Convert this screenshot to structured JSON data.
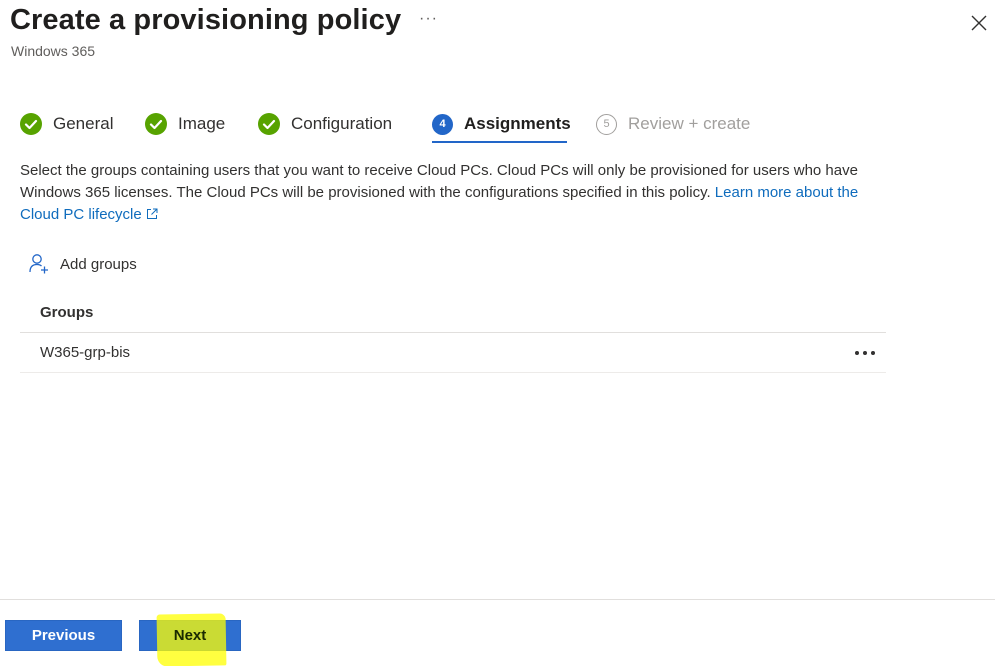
{
  "header": {
    "title": "Create a provisioning policy",
    "more": "···",
    "subtitle": "Windows 365"
  },
  "steps": [
    {
      "label": "General",
      "state": "completed"
    },
    {
      "label": "Image",
      "state": "completed"
    },
    {
      "label": "Configuration",
      "state": "completed"
    },
    {
      "label": "Assignments",
      "state": "active",
      "number": "4"
    },
    {
      "label": "Review + create",
      "state": "pending",
      "number": "5"
    }
  ],
  "description": {
    "text": "Select the groups containing users that you want to receive Cloud PCs. Cloud PCs will only be provisioned for users who have Windows 365 licenses. The Cloud PCs will be provisioned with the configurations specified in this policy. ",
    "link": "Learn more about the Cloud PC lifecycle"
  },
  "toolbar": {
    "add_groups_label": "Add groups"
  },
  "table": {
    "header": "Groups",
    "rows": [
      {
        "name": "W365-grp-bis"
      }
    ]
  },
  "footer": {
    "previous_label": "Previous",
    "next_label": "Next"
  },
  "colors": {
    "accent": "#2266c8",
    "success": "#57a300",
    "highlight": "#ffff00"
  }
}
